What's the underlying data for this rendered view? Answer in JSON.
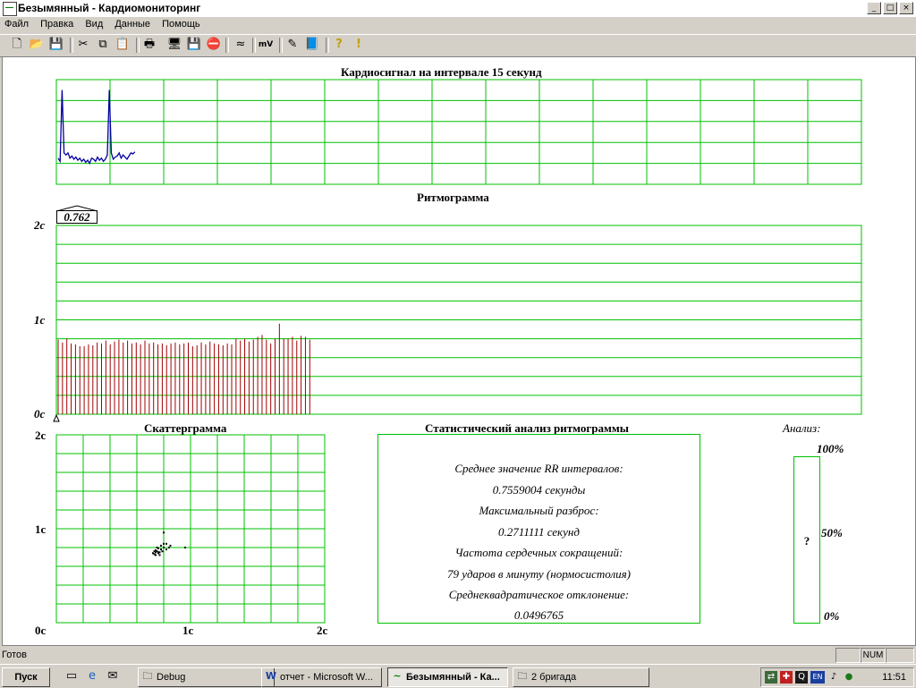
{
  "window": {
    "title": "Безымянный - Кардиомониторинг"
  },
  "menu": [
    "Файл",
    "Правка",
    "Вид",
    "Данные",
    "Помощь"
  ],
  "toolbar": [
    {
      "name": "new-file-icon",
      "glyph": "🗋"
    },
    {
      "name": "open-folder-icon",
      "glyph": "📂"
    },
    {
      "name": "save-icon",
      "glyph": "💾"
    },
    {
      "name": "cut-icon",
      "glyph": "✂"
    },
    {
      "name": "copy-icon",
      "glyph": "⧉"
    },
    {
      "name": "paste-icon",
      "glyph": "📋"
    },
    {
      "name": "print-icon",
      "glyph": "🖶"
    },
    {
      "name": "monitor-icon",
      "glyph": "🖥"
    },
    {
      "name": "disk-icon",
      "glyph": "💾"
    },
    {
      "name": "stop-icon",
      "glyph": "⛔"
    },
    {
      "name": "filter-icon",
      "glyph": "≈"
    },
    {
      "name": "millivolt-icon",
      "glyph": "mV"
    },
    {
      "name": "pen-icon",
      "glyph": "✎"
    },
    {
      "name": "book-icon",
      "glyph": "📘"
    },
    {
      "name": "help-icon",
      "glyph": "?"
    },
    {
      "name": "whatsthis-icon",
      "glyph": "!"
    }
  ],
  "ecg": {
    "title": "Кардиосигнал на интервале 15 секунд",
    "color": "#0000a0",
    "grid_color": "#00c000",
    "chart_data": {
      "type": "line",
      "samples": [
        0.25,
        0.22,
        0.9,
        0.3,
        0.28,
        0.3,
        0.25,
        0.27,
        0.24,
        0.26,
        0.23,
        0.25,
        0.22,
        0.24,
        0.21,
        0.23,
        0.2,
        0.25,
        0.24,
        0.22,
        0.26,
        0.23,
        0.25,
        0.22,
        0.24,
        0.28,
        0.9,
        0.3,
        0.24,
        0.26,
        0.27,
        0.3,
        0.25,
        0.28,
        0.26,
        0.24,
        0.27,
        0.3,
        0.29,
        0.31
      ]
    }
  },
  "rhythm": {
    "title": "Ритмограмма",
    "marker_value": "0.762",
    "y_labels": [
      "2с",
      "1с",
      "0с"
    ],
    "bar_color": "#a00000",
    "chart_data": {
      "type": "bar",
      "ylim": [
        0,
        2
      ],
      "values": [
        0.79,
        0.76,
        0.8,
        0.75,
        0.74,
        0.72,
        0.72,
        0.74,
        0.73,
        0.76,
        0.75,
        0.78,
        0.74,
        0.77,
        0.79,
        0.76,
        0.78,
        0.75,
        0.76,
        0.74,
        0.78,
        0.75,
        0.76,
        0.74,
        0.75,
        0.73,
        0.75,
        0.76,
        0.74,
        0.75,
        0.76,
        0.72,
        0.73,
        0.76,
        0.74,
        0.77,
        0.75,
        0.74,
        0.73,
        0.75,
        0.74,
        0.8,
        0.78,
        0.8,
        0.77,
        0.79,
        0.82,
        0.84,
        0.79,
        0.75,
        0.8,
        0.96,
        0.8,
        0.8,
        0.82,
        0.78,
        0.83,
        0.82,
        0.79
      ]
    }
  },
  "scatter": {
    "title": "Скаттерграмма",
    "y_labels": [
      "2с",
      "1с",
      "0с"
    ],
    "x_labels": [
      "1с",
      "2с"
    ],
    "chart_data": {
      "type": "scatter",
      "xlim": [
        0,
        2
      ],
      "ylim": [
        0,
        2
      ],
      "points": [
        [
          0.72,
          0.74
        ],
        [
          0.74,
          0.72
        ],
        [
          0.75,
          0.76
        ],
        [
          0.76,
          0.74
        ],
        [
          0.74,
          0.77
        ],
        [
          0.73,
          0.73
        ],
        [
          0.77,
          0.75
        ],
        [
          0.78,
          0.78
        ],
        [
          0.76,
          0.79
        ],
        [
          0.75,
          0.8
        ],
        [
          0.79,
          0.76
        ],
        [
          0.8,
          0.8
        ],
        [
          0.82,
          0.78
        ],
        [
          0.78,
          0.82
        ],
        [
          0.8,
          0.84
        ],
        [
          0.84,
          0.8
        ],
        [
          0.82,
          0.84
        ],
        [
          0.85,
          0.82
        ],
        [
          0.76,
          0.75
        ],
        [
          0.74,
          0.75
        ],
        [
          0.96,
          0.8
        ],
        [
          0.8,
          0.96
        ],
        [
          0.77,
          0.72
        ],
        [
          0.73,
          0.76
        ]
      ]
    }
  },
  "stats": {
    "title": "Статистический анализ ритмограммы",
    "lines": [
      "Среднее значение RR интервалов:",
      "0.7559004 секунды",
      "Максимальный разброс:",
      "0.2711111 секунд",
      "Частота сердечных сокращений:",
      "79 ударов в минуту (нормосистолия)",
      "Среднеквадратическое отклонение:",
      "0.0496765"
    ]
  },
  "analysis": {
    "title": "Анализ:",
    "labels": [
      "100%",
      "50%",
      "0%"
    ],
    "value": "?"
  },
  "status": {
    "text": "Готов",
    "num": "NUM"
  },
  "taskbar": {
    "start": "Пуск",
    "tasks": [
      {
        "label": "Debug",
        "icon": "folder-icon",
        "glyph": "🗀",
        "active": false
      },
      {
        "label": "отчет - Microsoft W...",
        "icon": "word-icon",
        "glyph": "W",
        "active": false
      },
      {
        "label": "Безымянный - Ка...",
        "icon": "app-icon",
        "glyph": "~",
        "active": true
      },
      {
        "label": "2 бригада",
        "icon": "folder-icon",
        "glyph": "🗀",
        "active": false
      }
    ],
    "clock": "11:51",
    "lang": "EN"
  }
}
